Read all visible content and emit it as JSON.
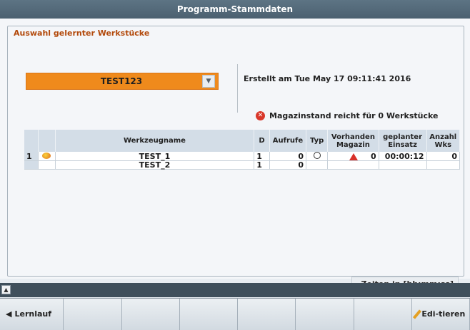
{
  "window": {
    "title": "Programm-Stammdaten"
  },
  "group": {
    "title": "Auswahl gelernter Werkstücke"
  },
  "select": {
    "value": "TEST123",
    "arrow_icon": "chevron-down-icon"
  },
  "info": {
    "created": "Erstellt am Tue May 17 09:11:41 2016",
    "warning": "Magazinstand reicht für 0 Werkstücke",
    "warning_icon": "error-icon"
  },
  "table": {
    "headers": {
      "name": "Werkzeugname",
      "d": "D",
      "aufrufe": "Aufrufe",
      "typ": "Typ",
      "vorhanden": "Vorhanden Magazin",
      "einsatz": "geplanter Einsatz",
      "anzahl": "Anzahl Wks"
    },
    "rows": [
      {
        "index": "1",
        "status_icon": "warning-flag-icon",
        "name": "TEST_1",
        "d": "1",
        "aufrufe": "0",
        "typ_icon": "clock-icon",
        "vorhanden_icon": "warning-triangle-icon",
        "vorhanden": "0",
        "einsatz": "00:00:12",
        "anzahl": "0"
      },
      {
        "index": "",
        "status_icon": "",
        "name": "TEST_2",
        "d": "1",
        "aufrufe": "0",
        "typ_icon": "",
        "vorhanden_icon": "",
        "vorhanden": "",
        "einsatz": "",
        "anzahl": ""
      }
    ]
  },
  "time_hint": "Zeiten in [hh:mm:ss]",
  "softkeys": {
    "learn": "Lernlauf",
    "edit": "Edi-tieren"
  },
  "colors": {
    "accent_orange": "#ef8a1c",
    "title_bar": "#4b6070",
    "header_bg": "#d3dde7",
    "error_red": "#d9382b"
  }
}
